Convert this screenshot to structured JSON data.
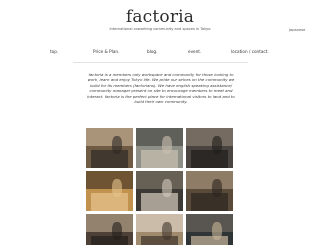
{
  "header": {
    "logo": "factoria",
    "tagline": "International coworking community and spaces in Tokyo",
    "language_link": "Japanese"
  },
  "nav": {
    "items": [
      {
        "label": "top."
      },
      {
        "label": "Price & Plan."
      },
      {
        "label": "blog."
      },
      {
        "label": "event."
      },
      {
        "label": "location / contact."
      }
    ]
  },
  "intro": {
    "text": "factoria is a members only workspace and community for those looking to work, learn and enjoy Tokyo life. We pride our selves on the community we build for its members (factorians). We have english speaking assistance/ community manager present on site to encourage members to meet and interact. factoria is the perfect place for international visitors to land and to build their own community."
  },
  "gallery": {
    "photos": [
      {
        "icon": "coworking-space-photo-icon",
        "colors": [
          "#6f5a44",
          "#d8c3a5",
          "#2e2a26"
        ]
      },
      {
        "icon": "member-working-photo-icon",
        "colors": [
          "#8e8f86",
          "#3b3a38",
          "#c9c0b0"
        ]
      },
      {
        "icon": "community-event-photo-icon",
        "colors": [
          "#4a4440",
          "#9a8c7c",
          "#1f1c1a"
        ]
      },
      {
        "icon": "bar-counter-photo-icon",
        "colors": [
          "#c1924e",
          "#2a211b",
          "#e6c58e"
        ]
      },
      {
        "icon": "laptop-work-photo-icon",
        "colors": [
          "#3d3a35",
          "#8a7f70",
          "#d4cbbd"
        ]
      },
      {
        "icon": "networking-photo-icon",
        "colors": [
          "#5a4a3a",
          "#b9a68d",
          "#2b2520"
        ]
      },
      {
        "icon": "members-group-photo-icon",
        "colors": [
          "#4d4036",
          "#cdb89a",
          "#231e1a"
        ]
      },
      {
        "icon": "kitchen-area-photo-icon",
        "colors": [
          "#a08a6e",
          "#ede6da",
          "#3f362c"
        ]
      },
      {
        "icon": "workshop-session-photo-icon",
        "colors": [
          "#2f3436",
          "#7c7166",
          "#c8b59a"
        ]
      }
    ]
  }
}
